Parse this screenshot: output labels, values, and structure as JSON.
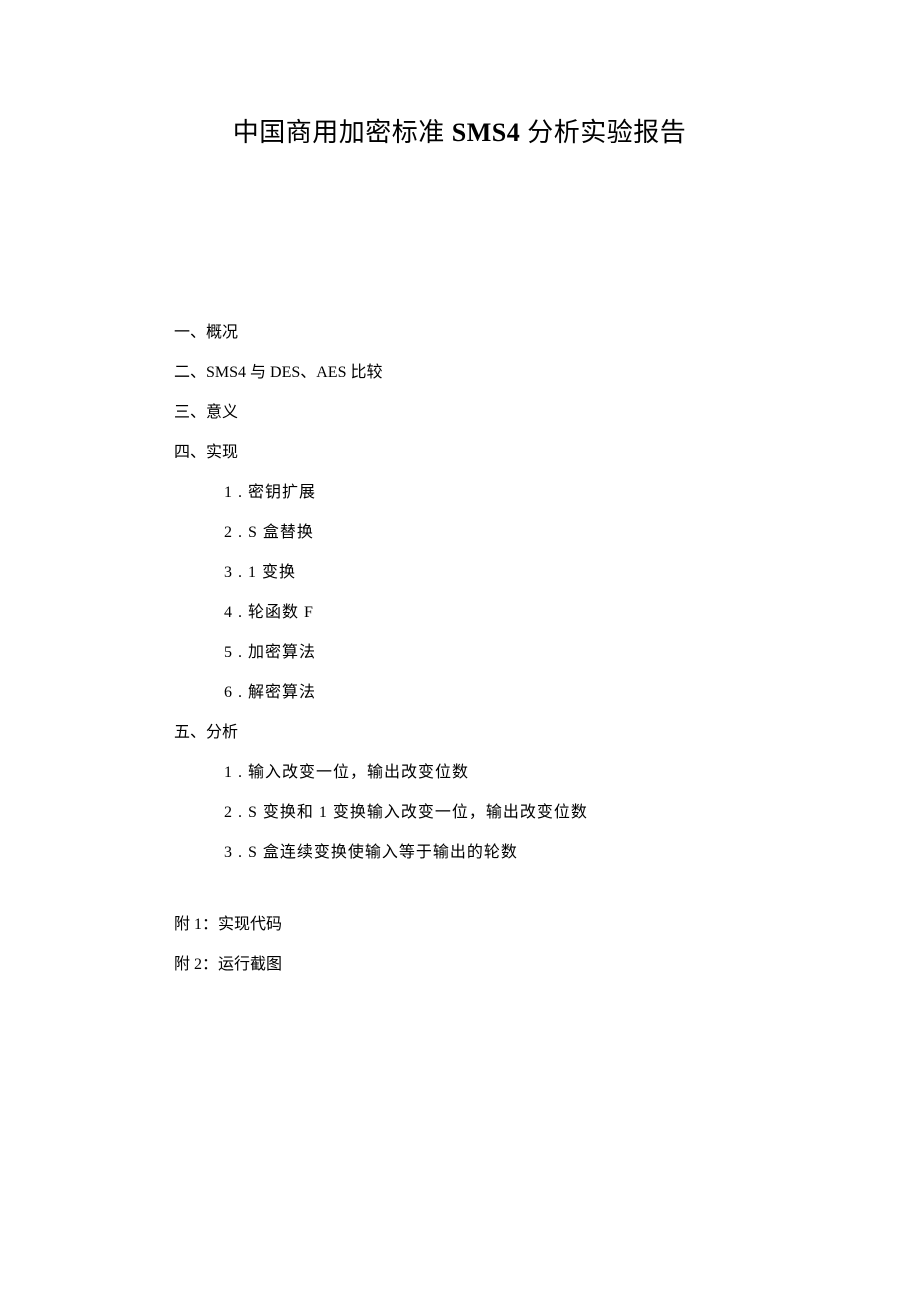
{
  "title_cn_prefix": "中国商用加密标准 ",
  "title_bold": "SMS4",
  "title_cn_suffix": " 分析实验报告",
  "toc": {
    "s1": "一、概况",
    "s2": "二、SMS4 与 DES、AES 比较",
    "s3": "三、意义",
    "s4": "四、实现",
    "s4_1": "1 . 密钥扩展",
    "s4_2": "2  . S 盒替换",
    "s4_3": "3  . 1 变换",
    "s4_4": "4  . 轮函数 F",
    "s4_5": "5  . 加密算法",
    "s4_6": "6  . 解密算法",
    "s5": "五、分析",
    "s5_1": "1 . 输入改变一位，输出改变位数",
    "s5_2": "2  . S 变换和 1 变换输入改变一位，输出改变位数",
    "s5_3": "3  . S 盒连续变换使输入等于输出的轮数",
    "a1": "附 1：实现代码",
    "a2": "附 2：运行截图"
  }
}
